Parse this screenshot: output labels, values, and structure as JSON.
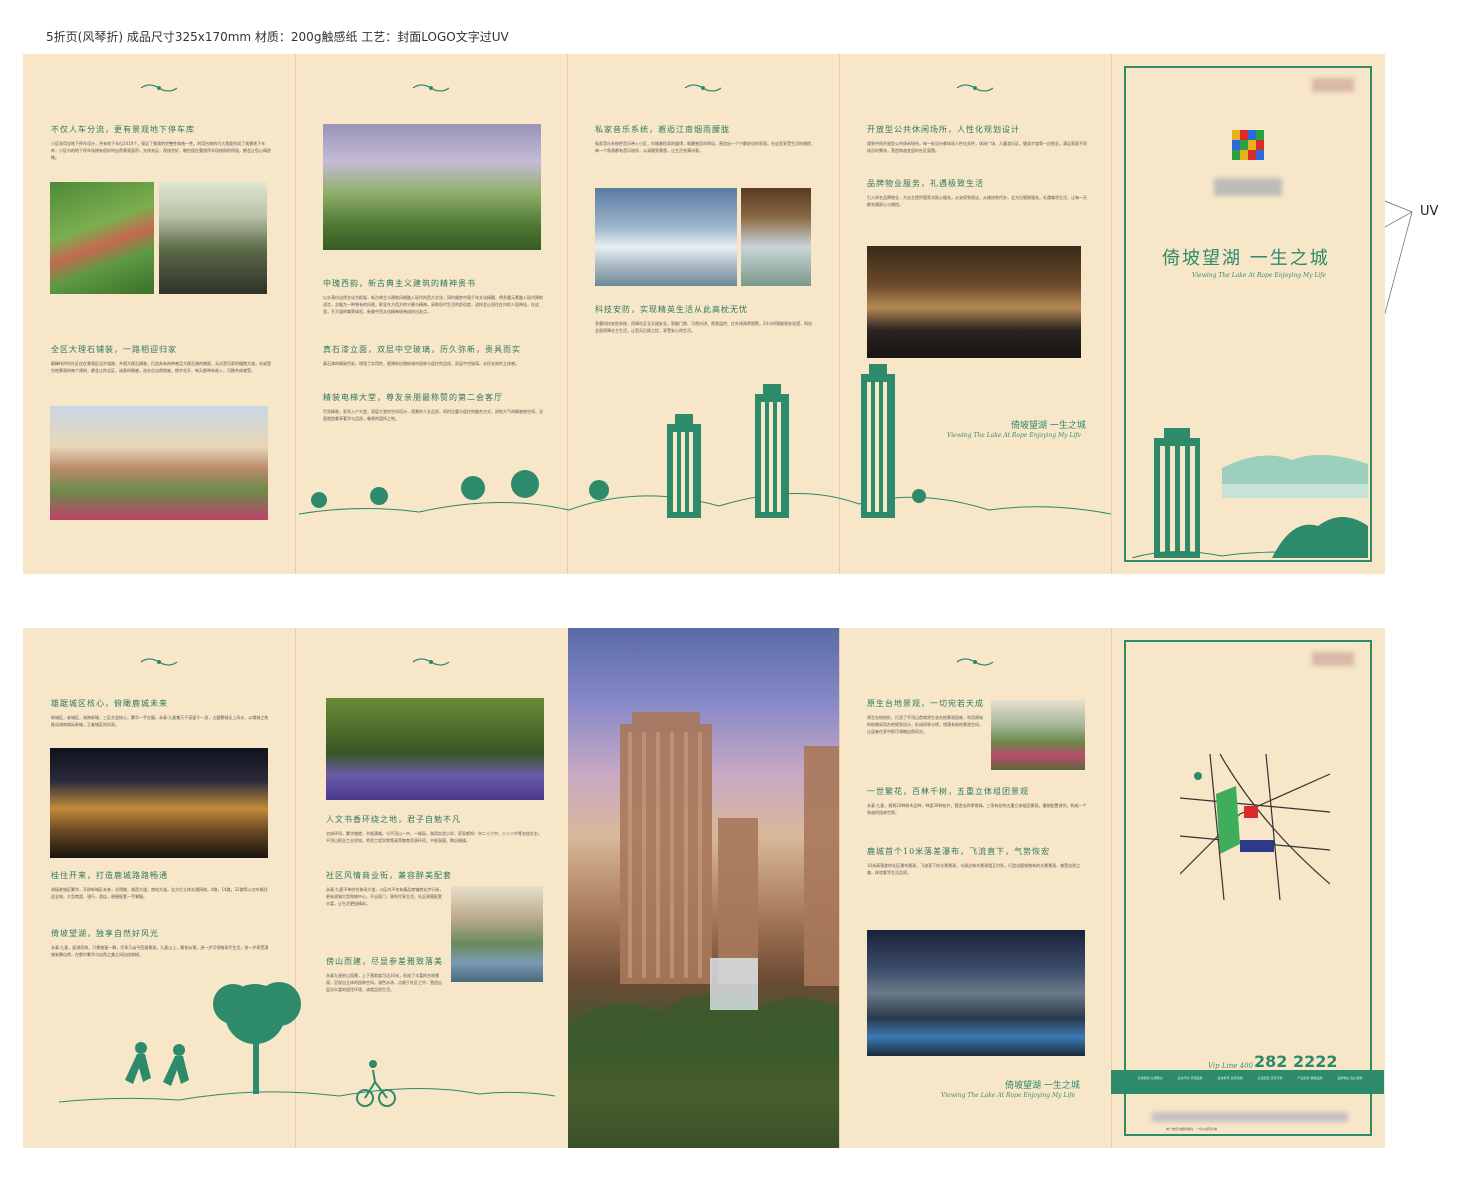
{
  "spec_note": "5折页(风琴折) 成品尺寸325x170mm  材质：200g触感纸  工艺：封面LOGO文字过UV",
  "uv_label": "UV",
  "top_sheet": {
    "panel1": {
      "heading1": "不仅人车分流，更有景观地下停车库",
      "text1": "小区采用全地下停车设计，共有地下车位2410个，保证了景观的完整性和统一性。利用台地的巧大落差形成了观景地下车库，小区内的地下停车场拥有很好的自然景观面积，光线充足，视线良好，敬怡居在重视停车场按照的停留，都会让您心情舒畅。",
      "heading2": "全区大理石铺装，一路相迎归家",
      "text2": "颠峰伟岸的社区仅在景观区设步道路，并随大理石铺装，打造具有热带感且大理石铺的铺面，无论是归家的慢跑大道，亦或是台地景观的每个建筑，都会让你全区，诚意的情感，选在近自然地被，移步花开，每天都带有收入，可期共体感受。"
    },
    "panel2": {
      "heading1": "中瑰西韵，新古典主义建筑的精神贵书",
      "text1": "以水滴仿自然文化为框架，新古典主义建筑风格融入现代的西方文化，同时顺势中国千年文化精髓，将多重元素融入现代建筑语言，交融为一种独有的风格，彰显东方西方的宁静与精神。采取现代生活的舒适度，这样会让居住在内的人居神仙，在这里，开大道的尊荣体验，新美中西文化精神极独成的出发点。",
      "heading2": "真石漆立面，双层中空玻璃，历久弥新，贵具而实",
      "text2": "真石漆的精致色彩，增强了实用性，更建筑出独栋城市园林与居住的品质，双层中空玻璃，永恒长效的立体感。",
      "heading3": "精装电梯大堂，尊友亲朋最称赞的第二会客厅",
      "text3": "尽览精装，家华入户大堂，双层大堂的空间设计，透景的人文品质，同时注重与居住的融合方式，质地大气的精装修空间，全面塑造尊享奢华与品质，尊贵的居所之地。"
    },
    "panel3": {
      "heading1": "私家音乐系统，邂逅江南烟雨朦胧",
      "text1": "私家音乐系统把音乐带入小区，伴随着悦耳的旋律，唤醒感官的律动，营造出一个宁静舒适的家园，在这里享受生活的愉悦，每一个角落都有音乐陪伴，从清晨到黄昏，让生活充满诗意。",
      "heading2": "科技安防，实现精英生活从此高枕无忧",
      "text2": "多重科技安防系统，保障社区全天候安全，智能门禁、可视对讲、视频监控、红外线周界报警，24小时智能保安巡逻，科技全面保障业主生活，让您无后顾之忧，享受安心的生活。"
    },
    "panel4": {
      "heading1": "开放型公共休闲场所，人性化规划设计",
      "text1": "规划中的开放型公共休闲场所，每一处设计都体现人性化关怀，休闲广场、儿童游乐区、健身步道等一应俱全，满足家庭不同成员的需求，营造和谐宜居的社区氛围。",
      "heading2": "品牌物业服务，礼遇极致生活",
      "text2": "引入知名品牌物业，为业主提供管家式贴心服务，从安保到保洁，从维修到代办，全方位细致服务，礼遇尊崇生活，让每一天都充满舒心与愉悦。",
      "slogan": "倚坡望湖 一生之城",
      "slogan_en": "Viewing The Lake At Rope Enjoying My Life"
    },
    "cover": {
      "slogan": "倚坡望湖  一生之城",
      "slogan_en": "Viewing The Lake At Rope Enjoying My Life"
    }
  },
  "bottom_sheet": {
    "panel1": {
      "heading1": "雄踞城区核心，俯瞰鹿城未来",
      "text1": "新城区，老城区，湖南新城，三区交会核心，繁华一手在握。永泰·九星集万千宠爱于一身，占据繁城无上风水，以增城之势推动湖南城际新城，王者城区的风采。",
      "heading2": "桂住开来，打造鹿城路路畅通",
      "text2": "承接老城区繁华，开辟新城区未来，光明路，湖滨大道，南电大道，全方位立体交通网络，4路，14路，22路等公交车辆往返全城，大型商超，银行，酒店，便捷配套一手掌握。",
      "heading3": "倚坡望湖，独享自然好风光",
      "text3": "永泰·九星，面湖而筑，只需推窗一瞬，尽享万亩平西湖景观，九星山上，繁花似锦，进一步可领略现代生活，进一步享受满城安静自然，在都市繁华与自然之美之间自由穿梭。"
    },
    "panel2": {
      "heading1": "人文书香环绕之地，君子自勉不凡",
      "text1": "名校环伺，繁华铺就，书香满城，与平顶山一中，一格局，湖滨实验小学，家家都知：市二十六中，二十八中等名校左右，平顶山职业工业学校，师资工程学院等高等教育资源环伺，书香氛围，陶冶情操。",
      "heading2": "社区风情商业街，兼容醉美配套",
      "text2": "永泰·九星不单综合休闲大道，小区内不仅有精品商铺商业步行街，更有双城大型购物中心，不出家门，便利尽享生活，社区周围配套丰富，让生活更加精彩。",
      "heading3": "傍山而建，尽显参差雅致落美",
      "text3": "永泰九星依山而建，上下落差度可达30米，形成了丰富的台地景观，呈现出立体的园林空间，湖色水泽，点缀于社区之中，营造出层次丰富的居住环境，成就品质生活。"
    },
    "panel4": {
      "heading1": "原生台地景观，一切宛若天成",
      "text1": "原生台地地形，打造了平顶山首席原生态台地景观园林，利用原始的地貌采用台地规划设计，形成四季分明，错落有致的景观空间，让居者在家中即可领略自然风光。",
      "heading2": "一世繁花，百林千树，五重立体组团景观",
      "text2": "永泰·九星，规划24种树木品种，种类30种花卉，营造出四季常绿，三季有花的五重立体组团景观，植物配置讲究，构成一个和谐的园林世界。",
      "heading3": "鹿城首个10米落差瀑布，飞流直下，气势恢宏",
      "text3": "10米高落差的社区瀑布景观，飞流直下的水景景观，与周边林木景观相互衬托，打造出鹿城独有的水景景观，感受自然之美，体验奢华生活品质。",
      "slogan": "倚坡望湖 一生之城",
      "slogan_en": "Viewing The Lake At Rope Enjoying My Life"
    },
    "back_cover": {
      "vip_label": "Vip Line 400",
      "hotline": "282 2222",
      "bar_items": [
        "交通便捷 交通畅达",
        "生态环境 景观宜居",
        "名校教育 资源优越",
        "生活配套 应有尽有",
        "产品优势 精致品质",
        "品牌物业 贴心服务"
      ],
      "footer_small": "本广告仅为要约邀请，一切以合同为准"
    }
  }
}
